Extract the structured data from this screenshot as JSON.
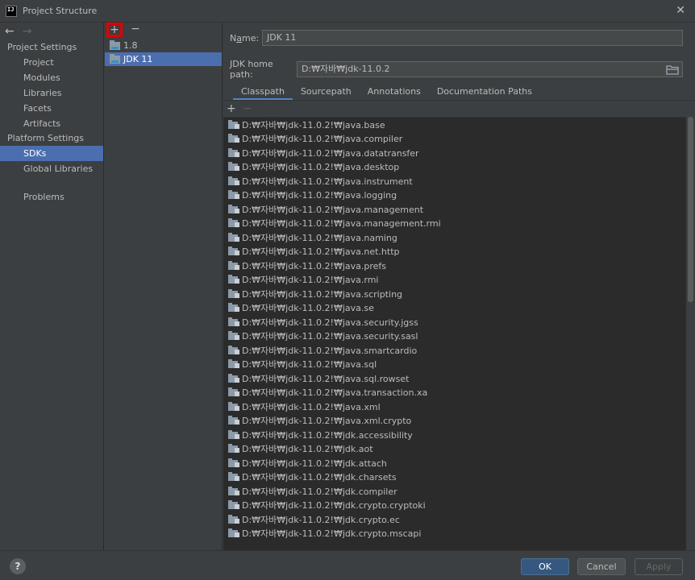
{
  "window": {
    "title": "Project Structure",
    "close_label": "✕",
    "app_icon_label": "IJ"
  },
  "nav": {
    "back": "←",
    "forward": "→"
  },
  "sidebar": {
    "project_settings_label": "Project Settings",
    "project_items": [
      "Project",
      "Modules",
      "Libraries",
      "Facets",
      "Artifacts"
    ],
    "platform_settings_label": "Platform Settings",
    "platform_items": [
      "SDKs",
      "Global Libraries"
    ],
    "problems_label": "Problems",
    "selected": "SDKs"
  },
  "sdk_panel": {
    "add_label": "+",
    "remove_label": "−",
    "items": [
      "1.8",
      "JDK 11"
    ],
    "selected": "JDK 11"
  },
  "detail": {
    "name_label_pre": "N",
    "name_label_accel": "a",
    "name_label_post": "me:",
    "name_value": "JDK 11",
    "home_label": "JDK home path:",
    "home_value": "D:₩자바₩jdk-11.0.2",
    "tabs": [
      "Classpath",
      "Sourcepath",
      "Annotations",
      "Documentation Paths"
    ],
    "active_tab": "Classpath",
    "cp_add": "+",
    "cp_remove": "−",
    "classpath": [
      "D:₩자바₩jdk-11.0.2!₩java.base",
      "D:₩자바₩jdk-11.0.2!₩java.compiler",
      "D:₩자바₩jdk-11.0.2!₩java.datatransfer",
      "D:₩자바₩jdk-11.0.2!₩java.desktop",
      "D:₩자바₩jdk-11.0.2!₩java.instrument",
      "D:₩자바₩jdk-11.0.2!₩java.logging",
      "D:₩자바₩jdk-11.0.2!₩java.management",
      "D:₩자바₩jdk-11.0.2!₩java.management.rmi",
      "D:₩자바₩jdk-11.0.2!₩java.naming",
      "D:₩자바₩jdk-11.0.2!₩java.net.http",
      "D:₩자바₩jdk-11.0.2!₩java.prefs",
      "D:₩자바₩jdk-11.0.2!₩java.rmi",
      "D:₩자바₩jdk-11.0.2!₩java.scripting",
      "D:₩자바₩jdk-11.0.2!₩java.se",
      "D:₩자바₩jdk-11.0.2!₩java.security.jgss",
      "D:₩자바₩jdk-11.0.2!₩java.security.sasl",
      "D:₩자바₩jdk-11.0.2!₩java.smartcardio",
      "D:₩자바₩jdk-11.0.2!₩java.sql",
      "D:₩자바₩jdk-11.0.2!₩java.sql.rowset",
      "D:₩자바₩jdk-11.0.2!₩java.transaction.xa",
      "D:₩자바₩jdk-11.0.2!₩java.xml",
      "D:₩자바₩jdk-11.0.2!₩java.xml.crypto",
      "D:₩자바₩jdk-11.0.2!₩jdk.accessibility",
      "D:₩자바₩jdk-11.0.2!₩jdk.aot",
      "D:₩자바₩jdk-11.0.2!₩jdk.attach",
      "D:₩자바₩jdk-11.0.2!₩jdk.charsets",
      "D:₩자바₩jdk-11.0.2!₩jdk.compiler",
      "D:₩자바₩jdk-11.0.2!₩jdk.crypto.cryptoki",
      "D:₩자바₩jdk-11.0.2!₩jdk.crypto.ec",
      "D:₩자바₩jdk-11.0.2!₩jdk.crypto.mscapi"
    ]
  },
  "buttons": {
    "help": "?",
    "ok": "OK",
    "cancel": "Cancel",
    "apply": "Apply"
  },
  "colors": {
    "background": "#3c3f41",
    "list_bg": "#2b2b2b",
    "selection": "#4b6eaf",
    "highlight_box": "#e00000"
  }
}
